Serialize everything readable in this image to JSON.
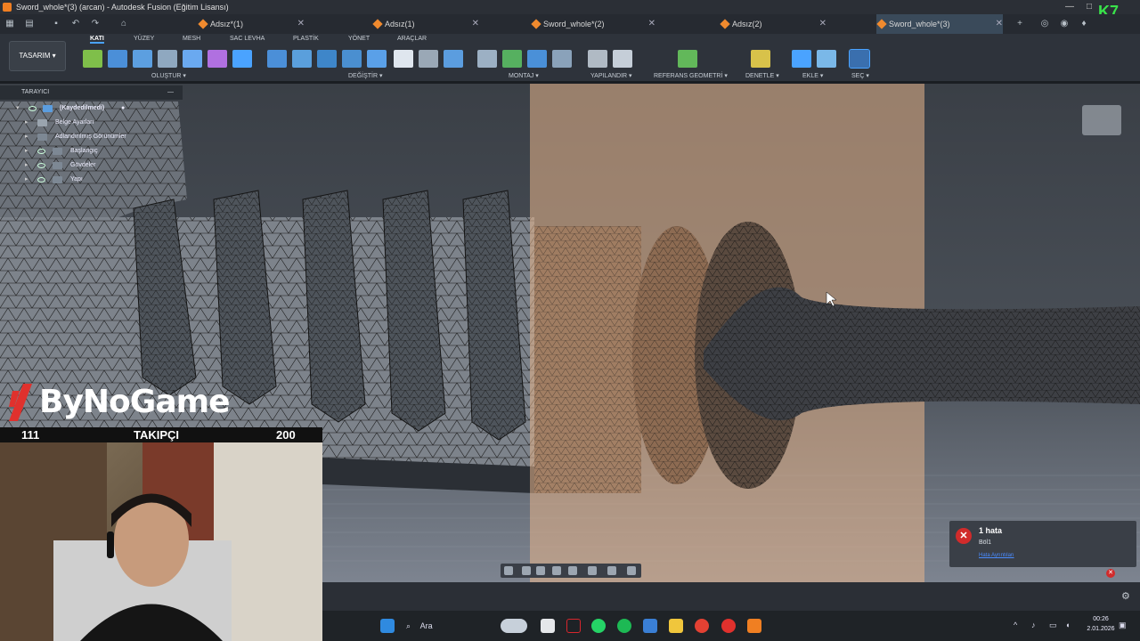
{
  "window": {
    "title": "Sword_whole*(3) (arcan) - Autodesk Fusion (Eğitim Lisansı)"
  },
  "tabs": [
    {
      "label": "Adsız*(1)",
      "active": false
    },
    {
      "label": "Adsız(1)",
      "active": false
    },
    {
      "label": "Sword_whole*(2)",
      "active": false
    },
    {
      "label": "Adsız(2)",
      "active": false
    },
    {
      "label": "Sword_whole*(3)",
      "active": true
    }
  ],
  "ribbon": {
    "mode_label": "TASARIM",
    "tabs": [
      "KATI",
      "YÜZEY",
      "MESH",
      "SAC LEVHA",
      "PLASTİK",
      "YÖNET",
      "ARAÇLAR"
    ],
    "active_tab": "KATI",
    "groups": [
      "OLUŞTUR",
      "DEĞİŞTİR",
      "MONTAJ",
      "YAPILANDIR",
      "REFERANS GEOMETRİ",
      "DENETLE",
      "EKLE",
      "SEÇ"
    ]
  },
  "browser": {
    "header": "TARAYICI",
    "root": "(Kaydedilmedi)",
    "items": [
      {
        "label": "Belge Ayarları"
      },
      {
        "label": "Adlandırılmış Görünümler"
      },
      {
        "label": "Başlangıç"
      },
      {
        "label": "Gövdeler"
      },
      {
        "label": "Yapı"
      }
    ]
  },
  "error_toast": {
    "title": "1 hata",
    "message": "Böl1",
    "link": "Hata Ayrıntıları"
  },
  "streamer": {
    "brand": "ByNoGame",
    "left_count": "111",
    "label": "TAKIPÇI",
    "right_count": "200"
  },
  "badge": {
    "text": "K7"
  },
  "taskbar": {
    "search_label": "Ara",
    "time": "00:26",
    "date": "2.01.2026"
  },
  "colors": {
    "accent": "#4aa3ff",
    "error": "#d12b2b",
    "fusion_orange": "#f07f22",
    "brand_red": "#e0312d",
    "badge_green": "#39e34a"
  }
}
